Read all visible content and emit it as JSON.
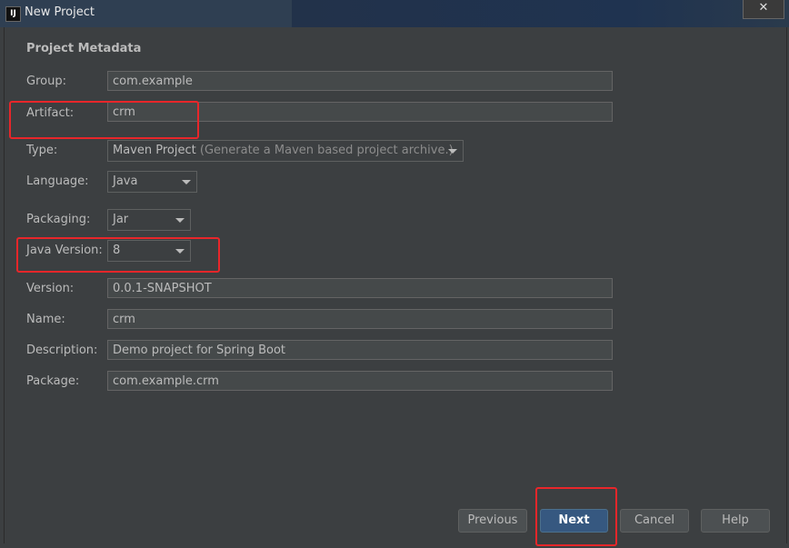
{
  "window": {
    "title": "New Project",
    "app_icon": "IJ",
    "close_glyph": "✕"
  },
  "section_title": "Project Metadata",
  "fields": {
    "group": {
      "label": "Group:",
      "value": "com.example"
    },
    "artifact": {
      "label": "Artifact:",
      "value": "crm"
    },
    "type": {
      "label": "Type:",
      "value": "Maven Project",
      "hint": "(Generate a Maven based project archive.)"
    },
    "language": {
      "label": "Language:",
      "value": "Java"
    },
    "packaging": {
      "label": "Packaging:",
      "value": "Jar"
    },
    "java_version": {
      "label": "Java Version:",
      "value": "8"
    },
    "version": {
      "label": "Version:",
      "value": "0.0.1-SNAPSHOT"
    },
    "name": {
      "label": "Name:",
      "value": "crm"
    },
    "description": {
      "label": "Description:",
      "value": "Demo project for Spring Boot"
    },
    "package": {
      "label": "Package:",
      "value": "com.example.crm"
    }
  },
  "buttons": {
    "previous": "Previous",
    "next": "Next",
    "cancel": "Cancel",
    "help": "Help"
  },
  "colors": {
    "accent": "#365880",
    "highlight": "#e8262a",
    "background": "#3c3f41"
  }
}
